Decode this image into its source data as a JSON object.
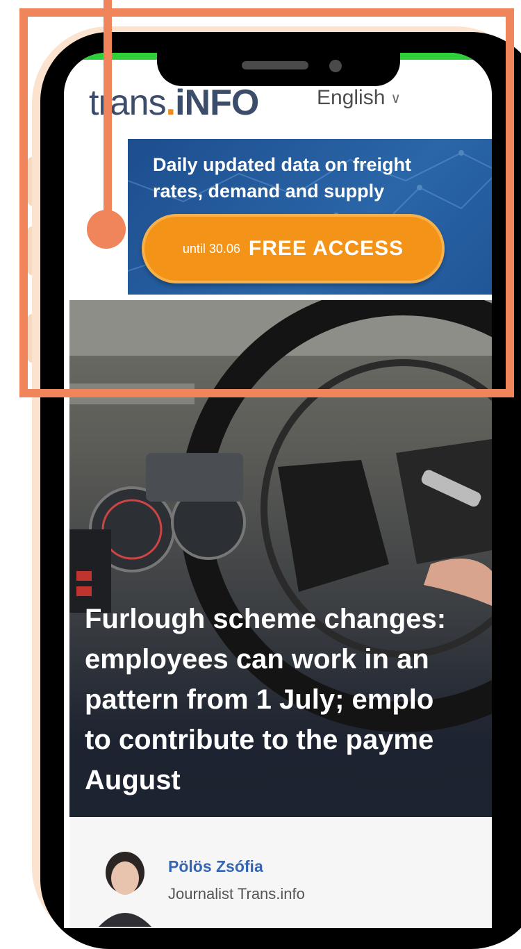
{
  "header": {
    "logo": {
      "part1": "trans",
      "dot": ".",
      "part2": "iNFO"
    },
    "language": "English"
  },
  "banner": {
    "headline_line1": "Daily updated data on freight",
    "headline_line2": "rates, demand and supply",
    "cta_small": "until 30.06",
    "cta_big": "FREE ACCESS"
  },
  "article": {
    "title_lines": [
      "Furlough scheme changes:",
      "employees can work in an",
      "pattern from 1 July; emplo",
      "to contribute to the payme",
      "August"
    ]
  },
  "author": {
    "name": "Pölös Zsófia",
    "role": "Journalist Trans.info"
  },
  "colors": {
    "frame": "#f0845a",
    "brand_blue": "#3b4d6b",
    "brand_orange": "#f28a22",
    "banner_blue": "#1d4e8e",
    "cta_orange": "#f39419",
    "status_green": "#2fcf3a",
    "author_link": "#3466b5"
  }
}
